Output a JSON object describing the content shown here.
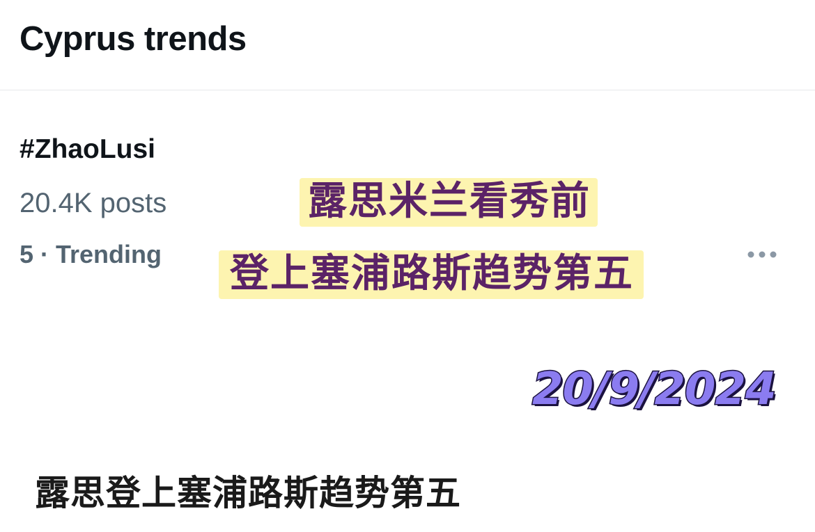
{
  "header": {
    "title": "Cyprus trends"
  },
  "trend": {
    "hashtag": "#ZhaoLusi",
    "posts": "20.4K posts",
    "rank": "5 · Trending",
    "more_icon": "more-horizontal-icon"
  },
  "overlay": {
    "caption_line_1": "露思米兰看秀前",
    "caption_line_2": "登上塞浦路斯趋势第五",
    "date": "20/9/2024",
    "bottom_caption": "露思登上塞浦路斯趋势第五",
    "colors": {
      "caption_text": "#5b2367",
      "caption_highlight": "#fdf4b0",
      "date_fill": "#8b7cf0",
      "date_outline": "#1b1240"
    }
  }
}
